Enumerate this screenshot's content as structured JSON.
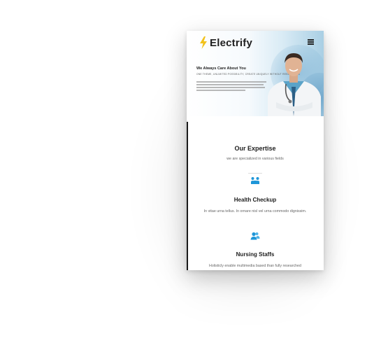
{
  "brand": {
    "name": "Electrify",
    "bolt_color": "#f2c21b"
  },
  "accent": "#1e96d8",
  "hero": {
    "heading": "We Always Care About You",
    "subheading": "ONE THEME, UNLIMITED POSSIBILITY, CREATE UNIQUELY WITHOUT RESEARCHES"
  },
  "menu_icon": "hamburger-icon",
  "expertise": {
    "title": "Our Expertise",
    "subtitle": "we are specialized in various fields"
  },
  "services": [
    {
      "icon": "handshake-icon",
      "title": "Health Checkup",
      "text": "In vitae urna tellus. In ornare nisl vel urna commodo dignissim."
    },
    {
      "icon": "users-icon",
      "title": "Nursing Staffs",
      "text": "Holisticly enable multimedia based than fully researched"
    }
  ]
}
